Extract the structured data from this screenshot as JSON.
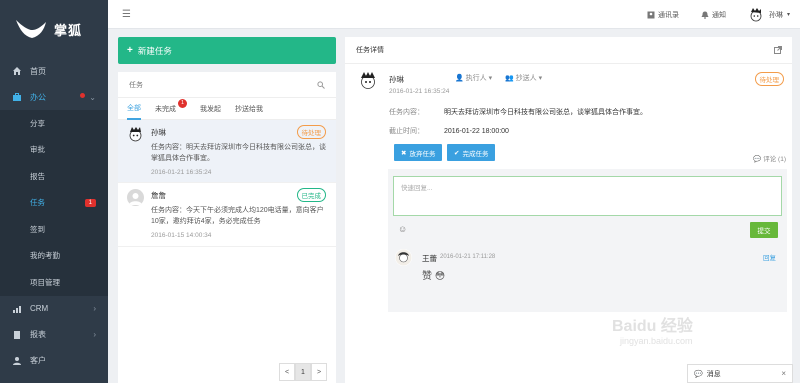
{
  "app": {
    "name": "掌狐"
  },
  "sidebar": {
    "items": [
      {
        "label": "首页"
      },
      {
        "label": "办公"
      }
    ],
    "sub": [
      {
        "label": "分享"
      },
      {
        "label": "审批"
      },
      {
        "label": "报告"
      },
      {
        "label": "任务",
        "badge": "1"
      },
      {
        "label": "签到"
      },
      {
        "label": "我的考勤"
      },
      {
        "label": "项目管理"
      }
    ],
    "bottom": [
      {
        "label": "CRM"
      },
      {
        "label": "报表"
      },
      {
        "label": "客户"
      }
    ]
  },
  "topbar": {
    "contacts": "通讯录",
    "notify": "通知",
    "user": "孙琳"
  },
  "left": {
    "new_task": "新建任务",
    "search_label": "任务",
    "tabs": [
      {
        "label": "全部",
        "active": true
      },
      {
        "label": "未完成",
        "badge": "1"
      },
      {
        "label": "我发起"
      },
      {
        "label": "抄送给我"
      }
    ],
    "tasks": [
      {
        "name": "孙琳",
        "status": "待处理",
        "body": "任务内容：明天去拜访深圳市今日科技有限公司张总，谈掌狐具体合作事宜。",
        "time": "2016-01-21 16:35:24"
      },
      {
        "name": "詹詹",
        "status": "已完成",
        "body": "任务内容：今天下午必须完成人均120电话量，意向客户10家，邀约拜访4家，务必完成任务",
        "time": "2016-01-15 14:00:34"
      }
    ],
    "pager": {
      "prev": "<",
      "page": "1",
      "next": ">"
    }
  },
  "detail": {
    "title": "任务详情",
    "name": "孙琳",
    "time": "2016-01-21 16:35:24",
    "executor": "执行人",
    "cc": "抄送人",
    "status": "待处理",
    "content_label": "任务内容：",
    "content": "明天去拜访深圳市今日科技有限公司张总，谈掌狐具体合作事宜。",
    "deadline_label": "截止时间：",
    "deadline": "2016-01-22 18:00:00",
    "btn_abandon": "放弃任务",
    "btn_complete": "完成任务",
    "comment_count": "评论 (1)",
    "reply_placeholder": "快速回复...",
    "submit": "提交",
    "comment": {
      "name": "王蕾",
      "time": "2016-01-21 17:11:28",
      "reply": "回复",
      "emo": "赞 😳"
    }
  },
  "chat": {
    "label": "消息"
  },
  "watermark": {
    "text": "Baidu 经验",
    "url": "jingyan.baidu.com"
  }
}
